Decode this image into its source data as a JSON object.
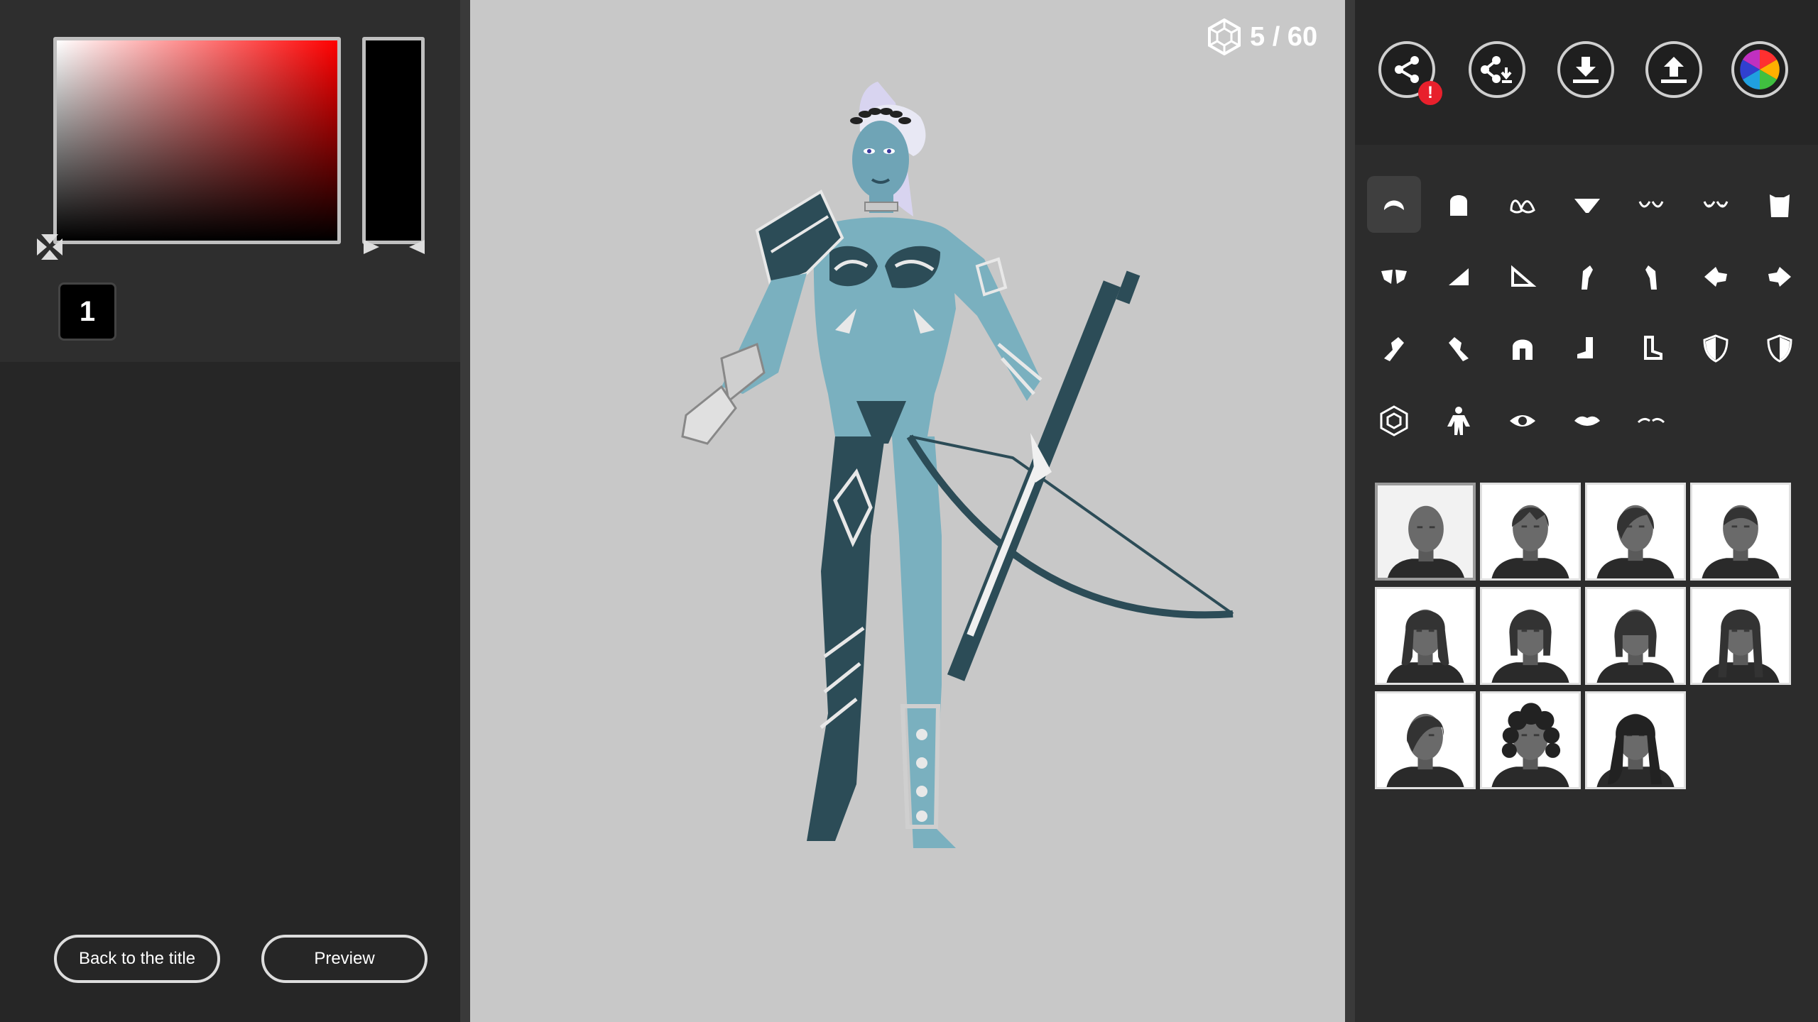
{
  "color_picker": {
    "slot_number": "1",
    "selected_hue": "#ff0000",
    "current_color": "#000000"
  },
  "buttons": {
    "back": "Back to the title",
    "preview": "Preview"
  },
  "counter": {
    "icon": "hexagon-parts-icon",
    "text": "5 / 60"
  },
  "toolbar": [
    {
      "name": "share-button",
      "icon": "share-icon",
      "alert": "!"
    },
    {
      "name": "share-download-button",
      "icon": "share-download-icon"
    },
    {
      "name": "download-button",
      "icon": "download-icon"
    },
    {
      "name": "upload-button",
      "icon": "upload-icon"
    },
    {
      "name": "color-wheel-button",
      "icon": "color-wheel-icon"
    }
  ],
  "categories": [
    "hair",
    "head",
    "bra",
    "panties",
    "chest-small",
    "chest-nipples",
    "torso",
    "shoulder-pads",
    "armor-left",
    "armor-right",
    "arm-left",
    "arm-right",
    "hand-left",
    "hand-right",
    "gauntlet-left",
    "gauntlet-right",
    "helmet",
    "boot-right",
    "boot-left",
    "shield-left",
    "shield-right",
    "parts",
    "body",
    "eye",
    "lips",
    "eyebrows"
  ],
  "hair_styles": [
    "bald",
    "short-messy",
    "side-swept",
    "slicked-back",
    "wavy-medium",
    "bob",
    "bangs-bob",
    "long-braided",
    "side-part-short",
    "curly-afro",
    "long-wavy"
  ],
  "colors": {
    "accent_alert": "#e8202c",
    "viewport_bg": "#c8c8c8",
    "skin": "#7ab0bf"
  }
}
